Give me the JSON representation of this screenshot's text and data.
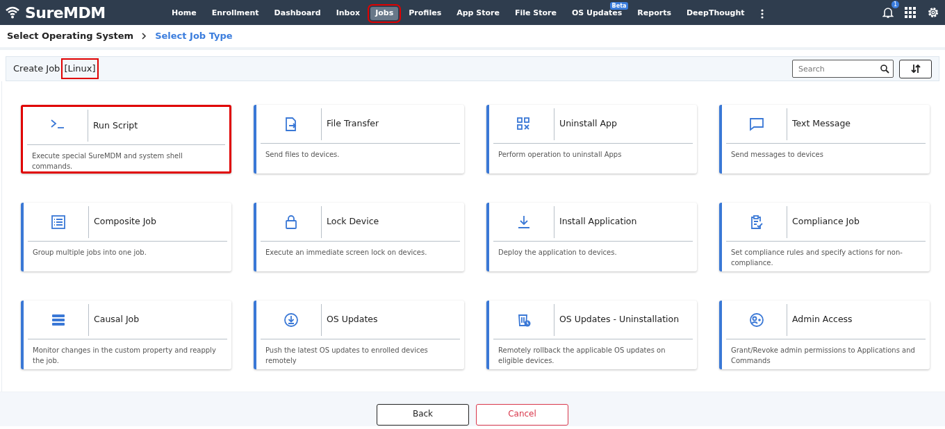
{
  "brand": "SureMDM",
  "nav": [
    {
      "label": "Home",
      "selected": false,
      "highlighted": false
    },
    {
      "label": "Enrollment",
      "selected": false,
      "highlighted": false
    },
    {
      "label": "Dashboard",
      "selected": false,
      "highlighted": false
    },
    {
      "label": "Inbox",
      "selected": false,
      "highlighted": false
    },
    {
      "label": "Jobs",
      "selected": true,
      "highlighted": true
    },
    {
      "label": "Profiles",
      "selected": false,
      "highlighted": false
    },
    {
      "label": "App Store",
      "selected": false,
      "highlighted": false
    },
    {
      "label": "File Store",
      "selected": false,
      "highlighted": false
    },
    {
      "label": "OS Updates",
      "selected": false,
      "highlighted": false,
      "badge": "Beta"
    },
    {
      "label": "Reports",
      "selected": false,
      "highlighted": false
    },
    {
      "label": "DeepThought",
      "selected": false,
      "highlighted": false
    }
  ],
  "notification_count": "1",
  "breadcrumb": [
    {
      "label": "Select Operating System",
      "selected": false
    },
    {
      "label": "Select Job Type",
      "selected": true
    }
  ],
  "toolbar": {
    "title": "Create Job",
    "os": "[Linux]",
    "os_highlighted": true,
    "search": {
      "placeholder": "Search"
    }
  },
  "cards": [
    {
      "title": "Run Script",
      "description": "Execute special SureMDM and system shell commands.",
      "highlighted": true
    },
    {
      "title": "File Transfer",
      "description": "Send files to devices.",
      "highlighted": false
    },
    {
      "title": "Uninstall App",
      "description": "Perform operation to uninstall Apps",
      "highlighted": false
    },
    {
      "title": "Text Message",
      "description": "Send messages to devices",
      "highlighted": false
    },
    {
      "title": "Composite Job",
      "description": "Group multiple jobs into one job.",
      "highlighted": false
    },
    {
      "title": "Lock Device",
      "description": "Execute an immediate screen lock on devices.",
      "highlighted": false
    },
    {
      "title": "Install Application",
      "description": "Deploy the application to devices.",
      "highlighted": false
    },
    {
      "title": "Compliance Job",
      "description": "Set compliance rules and specify actions for non-compliance.",
      "highlighted": false
    },
    {
      "title": "Causal Job",
      "description": "Monitor changes in the custom property and reapply the job.",
      "highlighted": false
    },
    {
      "title": "OS Updates",
      "description": "Push the latest OS updates to enrolled devices remotely",
      "highlighted": false
    },
    {
      "title": "OS Updates - Uninstallation",
      "description": "Remotely rollback the applicable OS updates on eligible devices.",
      "highlighted": false
    },
    {
      "title": "Admin Access",
      "description": "Grant/Revoke admin permissions to Applications and Commands",
      "highlighted": false
    }
  ],
  "buttons": [
    {
      "label": "Back",
      "kind": "secondary"
    },
    {
      "label": "Cancel",
      "kind": "danger"
    }
  ]
}
